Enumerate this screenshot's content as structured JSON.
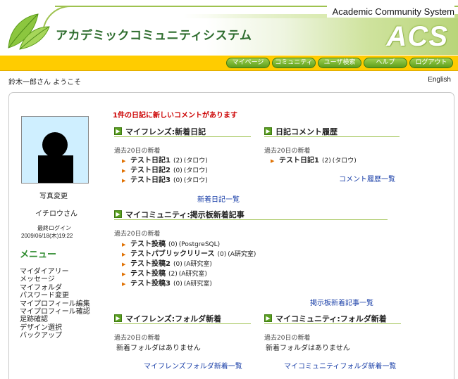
{
  "header": {
    "app_title": "アカデミックコミュニティシステム",
    "system_name": "Academic Community System",
    "logo_text": "ACS"
  },
  "nav": {
    "items": [
      {
        "label": "マイページ"
      },
      {
        "label": "コミュニティ"
      },
      {
        "label": "ユーザ検索"
      },
      {
        "label": "ヘルプ"
      },
      {
        "label": "ログアウト"
      }
    ]
  },
  "greeting": "鈴木一郎さん ようこそ",
  "language_link": "English",
  "sidebar": {
    "photo_change": "写真変更",
    "user_name": "イチロウさん",
    "last_login_label": "最終ログイン",
    "last_login_value": "2009/06/18(木)19:22",
    "menu_title": "メニュー",
    "menu_items": [
      {
        "label": "マイダイアリー"
      },
      {
        "label": "メッセージ"
      },
      {
        "label": "マイフォルダ"
      },
      {
        "label": "パスワード変更"
      },
      {
        "label": "マイプロフィール編集"
      },
      {
        "label": "マイプロフィール確認"
      },
      {
        "label": "足跡確認"
      },
      {
        "label": "デザイン選択"
      },
      {
        "label": "バックアップ"
      }
    ]
  },
  "notice": "1件の日記に新しいコメントがあります",
  "sections": {
    "friends_diary": {
      "title": "マイフレンズ:新着日記",
      "subtitle": "過去20日の新着",
      "entries": [
        {
          "title": "テスト日記1",
          "count": "(2)",
          "author": "(タロウ)"
        },
        {
          "title": "テスト日記2",
          "count": "(0)",
          "author": "(タロウ)"
        },
        {
          "title": "テスト日記3",
          "count": "(0)",
          "author": "(タロウ)"
        }
      ],
      "link": "新着日記一覧"
    },
    "diary_comments": {
      "title": "日記コメント履歴",
      "subtitle": "過去20日の新着",
      "entries": [
        {
          "title": "テスト日記1",
          "count": "(2)",
          "author": "(タロウ)"
        }
      ],
      "link": "コメント履歴一覧"
    },
    "community_bbs": {
      "title": "マイコミュニティ:掲示板新着記事",
      "subtitle": "過去20日の新着",
      "entries": [
        {
          "title": "テスト投稿",
          "count": "(0)",
          "author": "(PostgreSQL)"
        },
        {
          "title": "テストパブリックリリース",
          "count": "(0)",
          "author": "(A研究室)"
        },
        {
          "title": "テスト投稿2",
          "count": "(0)",
          "author": "(A研究室)"
        },
        {
          "title": "テスト投稿",
          "count": "(2)",
          "author": "(A研究室)"
        },
        {
          "title": "テスト投稿3",
          "count": "(0)",
          "author": "(A研究室)"
        }
      ],
      "link": "掲示板新着記事一覧"
    },
    "friends_folder": {
      "title": "マイフレンズ:フォルダ新着",
      "subtitle": "過去20日の新着",
      "empty": "新着フォルダはありません",
      "link": "マイフレンズフォルダ新着一覧"
    },
    "community_folder": {
      "title": "マイコミュニティ:フォルダ新着",
      "subtitle": "過去20日の新着",
      "empty": "新着フォルダはありません",
      "link": "マイコミュニティフォルダ新着一覧"
    }
  },
  "colors": {
    "nav_bar": "#ffcc00",
    "nav_button": "#5e9f1c",
    "accent_green": "#2e8b2e",
    "notice_red": "#cc0000",
    "link_blue": "#1a3fa8"
  }
}
